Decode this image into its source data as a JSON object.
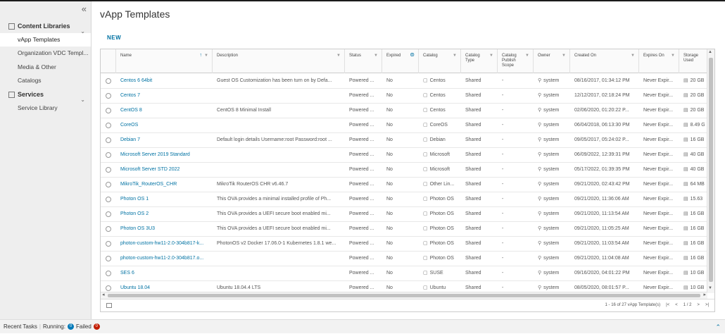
{
  "sidebar": {
    "collapse_icon": "«",
    "groups": [
      {
        "label": "Content Libraries",
        "items": [
          "vApp Templates",
          "Organization VDC Templ...",
          "Media & Other",
          "Catalogs"
        ]
      },
      {
        "label": "Services",
        "items": [
          "Service Library"
        ]
      }
    ]
  },
  "main": {
    "title": "vApp Templates",
    "new_label": "NEW"
  },
  "table": {
    "headers": [
      "Name",
      "Description",
      "Status",
      "Expired",
      "Catalog",
      "Catalog Type",
      "Catalog Publish Scope",
      "Owner",
      "Created On",
      "Expires On",
      "Storage Used"
    ],
    "rows": [
      [
        "Centos 6 64bit",
        "Guest OS Customization has been turn on by Defa...",
        "Powered ...",
        "No",
        "Centos",
        "Shared",
        "-",
        "system",
        "08/16/2017, 01:34:12 PM",
        "Never Expir...",
        "20 GB"
      ],
      [
        "Centos 7",
        "",
        "Powered ...",
        "No",
        "Centos",
        "Shared",
        "-",
        "system",
        "12/12/2017, 02:18:24 PM",
        "Never Expir...",
        "20 GB"
      ],
      [
        "CentOS 8",
        "CentOS 8 Minimal Install",
        "Powered ...",
        "No",
        "Centos",
        "Shared",
        "-",
        "system",
        "02/06/2020, 01:20:22 P...",
        "Never Expir...",
        "20 GB"
      ],
      [
        "CoreOS",
        "",
        "Powered ...",
        "No",
        "CoreOS",
        "Shared",
        "-",
        "system",
        "06/04/2018, 06:13:30 PM",
        "Never Expir...",
        "8.49 G"
      ],
      [
        "Debian 7",
        "Default login details Username:root Password:root ...",
        "Powered ...",
        "No",
        "Debian",
        "Shared",
        "-",
        "system",
        "09/05/2017, 05:24:02 P...",
        "Never Expir...",
        "16 GB"
      ],
      [
        "Microsoft Server 2019 Standard",
        "",
        "Powered ...",
        "No",
        "Microsoft",
        "Shared",
        "-",
        "system",
        "06/09/2022, 12:39:31 PM",
        "Never Expir...",
        "40 GB"
      ],
      [
        "Microsoft Server STD 2022",
        "",
        "Powered ...",
        "No",
        "Microsoft",
        "Shared",
        "-",
        "system",
        "05/17/2022, 01:39:35 PM",
        "Never Expir...",
        "40 GB"
      ],
      [
        "MikroTik_RouterOS_CHR",
        "MikroTik RouterOS CHR v6.46.7",
        "Powered ...",
        "No",
        "Other Lin...",
        "Shared",
        "-",
        "system",
        "09/21/2020, 02:43:42 PM",
        "Never Expir...",
        "64 MB"
      ],
      [
        "Photon OS 1",
        "This OVA provides a minimal installed profile of Ph...",
        "Powered ...",
        "No",
        "Photon OS",
        "Shared",
        "-",
        "system",
        "09/21/2020, 11:36:06 AM",
        "Never Expir...",
        "15.63"
      ],
      [
        "Photon OS 2",
        "This OVA provides a UEFI secure boot enabled mi...",
        "Powered ...",
        "No",
        "Photon OS",
        "Shared",
        "-",
        "system",
        "09/21/2020, 11:13:54 AM",
        "Never Expir...",
        "16 GB"
      ],
      [
        "Photon OS 3U3",
        "This OVA provides a UEFI secure boot enabled mi...",
        "Powered ...",
        "No",
        "Photon OS",
        "Shared",
        "-",
        "system",
        "09/21/2020, 11:05:25 AM",
        "Never Expir...",
        "16 GB"
      ],
      [
        "photon-custom-hw11-2.0-304b817-k...",
        "PhotonOS v2 Docker 17.06.0-1 Kubernetes 1.8.1 we...",
        "Powered ...",
        "No",
        "Photon OS",
        "Shared",
        "-",
        "system",
        "09/21/2020, 11:03:54 AM",
        "Never Expir...",
        "16 GB"
      ],
      [
        "photon-custom-hw11-2.0-304b817.o...",
        "",
        "Powered ...",
        "No",
        "Photon OS",
        "Shared",
        "-",
        "system",
        "09/21/2020, 11:04:08 AM",
        "Never Expir...",
        "16 GB"
      ],
      [
        "SES 6",
        "",
        "Powered ...",
        "No",
        "SUSE",
        "Shared",
        "-",
        "system",
        "09/16/2020, 04:01:22 PM",
        "Never Expir...",
        "10 GB"
      ],
      [
        "Ubuntu 18.04",
        "Ubuntu 18.04.4 LTS",
        "Powered ...",
        "No",
        "Ubuntu",
        "Shared",
        "-",
        "system",
        "08/05/2020, 08:01:57 P...",
        "Never Expir...",
        "10 GB"
      ]
    ]
  },
  "pagination": {
    "summary": "1 - 16 of 27 vApp Template(s)",
    "page_text": "1 / 2"
  },
  "bottom": {
    "recent_tasks": "Recent Tasks",
    "running_label": "Running:",
    "running_count": "0",
    "failed_label": "Failed",
    "failed_count": "0"
  },
  "colors": {
    "accent": "#0072a3",
    "running_badge": "#0079b8",
    "failed_badge": "#c21d00"
  }
}
